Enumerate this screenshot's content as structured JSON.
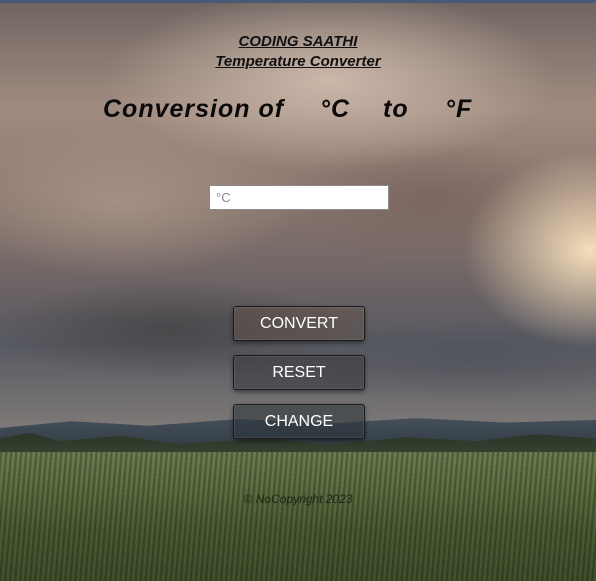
{
  "header": {
    "brand_name": "CODING SAATHI",
    "app_title": "Temperature Converter"
  },
  "conversion": {
    "label": "Conversion of",
    "from_unit": "°C",
    "connector": "to",
    "to_unit": "°F"
  },
  "input": {
    "placeholder": "°C",
    "value": ""
  },
  "buttons": {
    "convert_label": "CONVERT",
    "reset_label": "RESET",
    "change_label": "CHANGE"
  },
  "footer": {
    "copyright": "© NoCopyright 2023"
  },
  "colors": {
    "text_dark": "#111111",
    "button_text": "#ffffff",
    "top_bar": "#4a5a75"
  }
}
